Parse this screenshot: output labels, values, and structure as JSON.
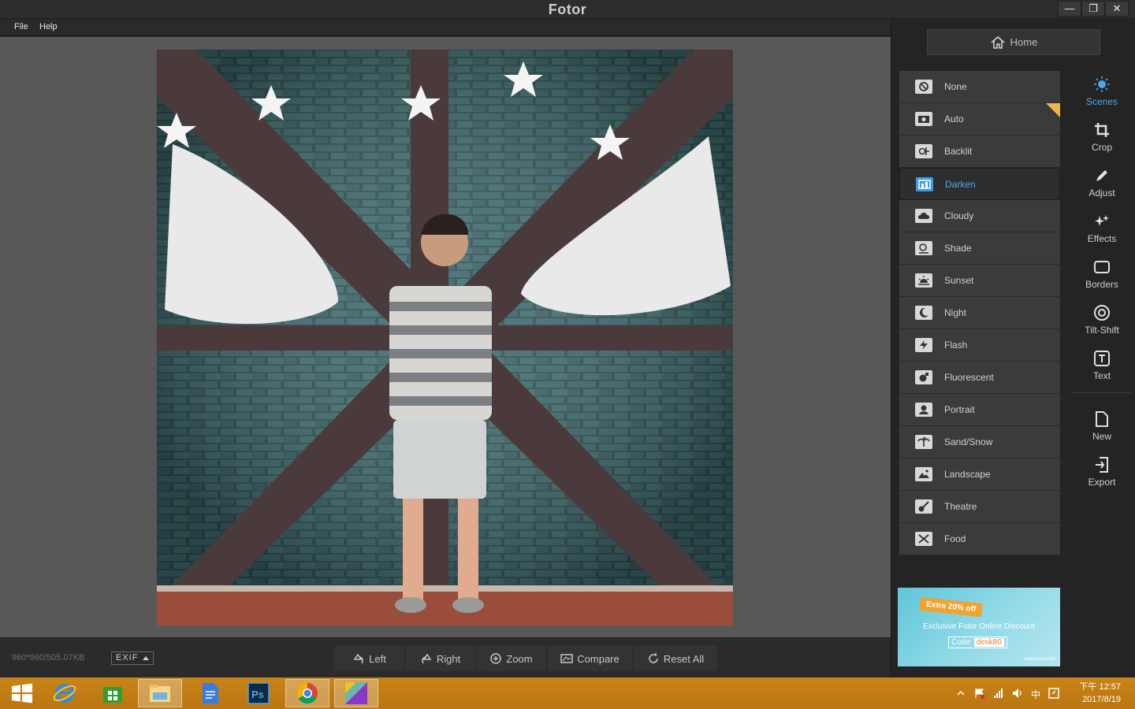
{
  "window": {
    "title": "Fotor",
    "controls": {
      "minimize": "—",
      "restore": "❐",
      "close": "✕"
    }
  },
  "menu": {
    "file": "File",
    "help": "Help"
  },
  "image_info": "960*960/505.07KB",
  "exif_label": "EXIF",
  "toolbar": {
    "left": "Left",
    "right": "Right",
    "zoom": "Zoom",
    "compare": "Compare",
    "reset_all": "Reset All"
  },
  "home_label": "Home",
  "scenes": {
    "items": [
      {
        "label": "None",
        "icon": "none-icon"
      },
      {
        "label": "Auto",
        "icon": "camera-icon"
      },
      {
        "label": "Backlit",
        "icon": "backlit-icon"
      },
      {
        "label": "Darken",
        "icon": "darken-icon"
      },
      {
        "label": "Cloudy",
        "icon": "cloud-icon"
      },
      {
        "label": "Shade",
        "icon": "shade-icon"
      },
      {
        "label": "Sunset",
        "icon": "sunset-icon"
      },
      {
        "label": "Night",
        "icon": "moon-icon"
      },
      {
        "label": "Flash",
        "icon": "flash-icon"
      },
      {
        "label": "Fluorescent",
        "icon": "bulb-icon"
      },
      {
        "label": "Portrait",
        "icon": "portrait-icon"
      },
      {
        "label": "Sand/Snow",
        "icon": "palm-icon"
      },
      {
        "label": "Landscape",
        "icon": "landscape-icon"
      },
      {
        "label": "Theatre",
        "icon": "guitar-icon"
      },
      {
        "label": "Food",
        "icon": "food-icon"
      }
    ],
    "active": "Darken"
  },
  "side_nav": {
    "scenes": "Scenes",
    "crop": "Crop",
    "adjust": "Adjust",
    "effects": "Effects",
    "borders": "Borders",
    "tilt_shift": "Tilt-Shift",
    "text": "Text",
    "new": "New",
    "export": "Export"
  },
  "ad": {
    "badge": "Extra 20% off",
    "text": "Exclusive Fotor Online Discount",
    "code_label": "Code:",
    "code_value": "desk80",
    "url": "www.fotor.com"
  },
  "taskbar": {
    "clock_time": "下午 12:57",
    "clock_date": "2017/8/19",
    "ime": "中"
  },
  "colors": {
    "accent": "#4aa7f2",
    "taskbar": "#c98415",
    "panel": "#242424"
  }
}
